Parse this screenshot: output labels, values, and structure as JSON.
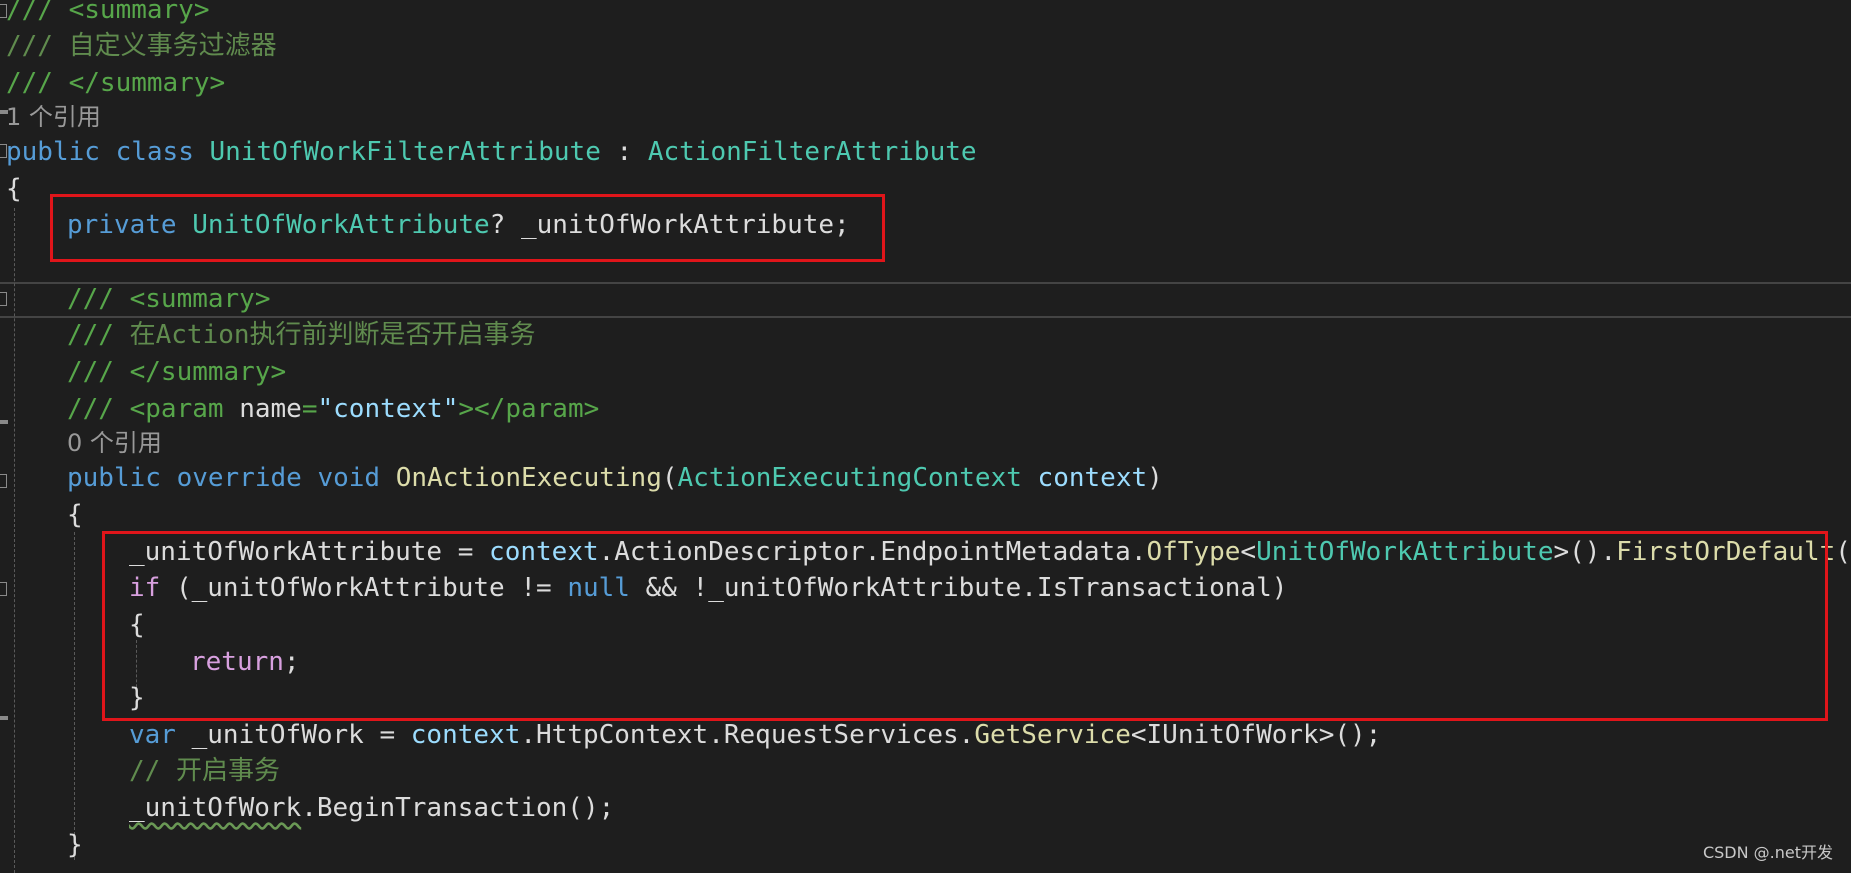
{
  "code": {
    "l1": {
      "text": "/// <summary>"
    },
    "l2": {
      "text": "/// 自定义事务过滤器"
    },
    "l3": {
      "text": "/// </summary>"
    },
    "l4": {
      "text": "1 个引用"
    },
    "l5": {
      "kw1": "public",
      "kw2": "class",
      "type": "UnitOfWorkFilterAttribute",
      "colon": " : ",
      "base": "ActionFilterAttribute"
    },
    "l6": {
      "text": "{"
    },
    "l7": {
      "kw": "private",
      "type": "UnitOfWorkAttribute",
      "rest": "? _unitOfWorkAttribute;"
    },
    "l8": {
      "text": "/// <summary>"
    },
    "l9": {
      "slashes": "/// ",
      "text": "在Action执行前判断是否开启事务"
    },
    "l10": {
      "text": "/// </summary>"
    },
    "l11": {
      "slashes": "/// ",
      "open": "<param ",
      "attr": "name",
      "eq": "=",
      "value": "\"context\"",
      "close": "></param>"
    },
    "l12": {
      "text": "0 个引用"
    },
    "l13": {
      "kw1": "public",
      "kw2": "override",
      "kw3": "void",
      "method": "OnActionExecuting",
      "paren_open": "(",
      "ptype": "ActionExecutingContext",
      "pname": "context",
      "paren_close": ")"
    },
    "l14": {
      "text": "{"
    },
    "l15": {
      "var": "_unitOfWorkAttribute",
      "eq": " = ",
      "ctx": "context",
      "chain": ".ActionDescriptor.EndpointMetadata.",
      "m1": "OfType",
      "lt": "<",
      "gtype": "UnitOfWorkAttribute",
      "gt": ">().",
      "m2": "FirstOrDefault",
      "end": "();"
    },
    "l16": {
      "kw": "if",
      "a": " (_unitOfWorkAttribute != ",
      "null": "null",
      "b": " && !_unitOfWorkAttribute.IsTransactional)"
    },
    "l17": {
      "text": "{"
    },
    "l18": {
      "kw": "return",
      "end": ";"
    },
    "l19": {
      "text": "}"
    },
    "l20": {
      "kw": "var",
      "name": "_unitOfWork",
      "eq": " = ",
      "ctx": "context",
      "chain": ".HttpContext.RequestServices.",
      "m": "GetService",
      "lt": "<",
      "gtype": "IUnitOfWork",
      "end": ">();"
    },
    "l21": {
      "text": "// 开启事务"
    },
    "l22": {
      "name": "_unitOfWork",
      "rest": ".BeginTransaction();"
    },
    "l23": {
      "text": "}"
    }
  },
  "watermark": "CSDN @.net开发",
  "colors": {
    "background": "#1e1e1e",
    "keyword": "#569cd6",
    "type": "#4ec9b0",
    "method": "#dcdcaa",
    "parameter": "#9cdcfe",
    "control": "#d8a0df",
    "comment": "#57a64a",
    "highlight_box": "#e0151a"
  }
}
